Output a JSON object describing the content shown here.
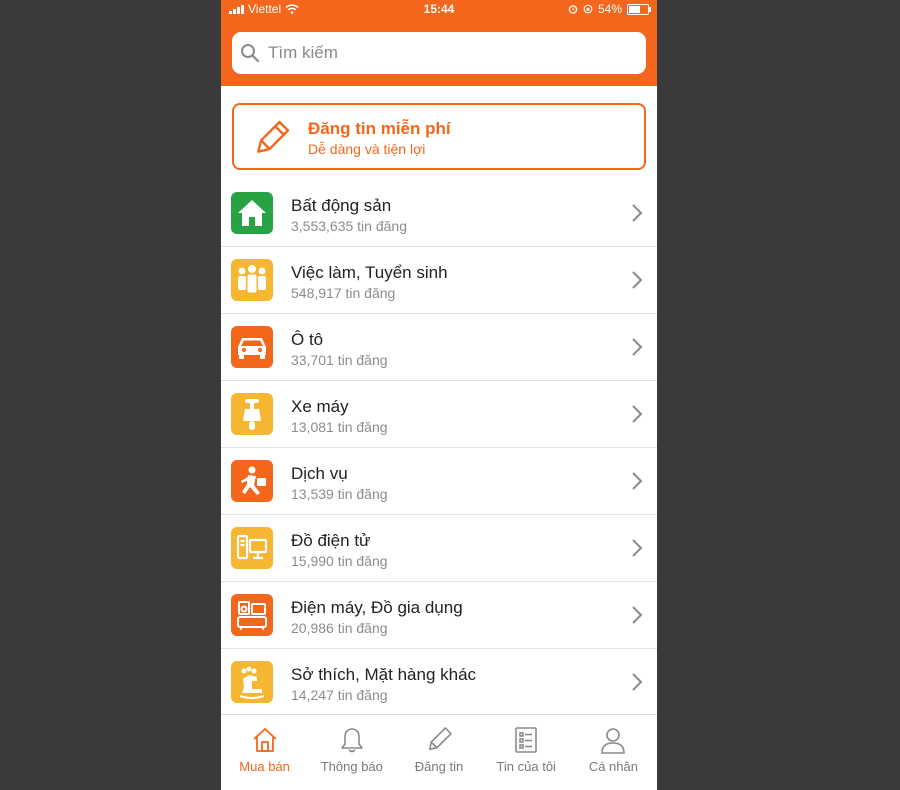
{
  "status_bar": {
    "carrier": "Viettel",
    "time": "15:44",
    "battery": "54%",
    "battery_level": 0.54
  },
  "search": {
    "placeholder": "Tìm kiếm"
  },
  "post_banner": {
    "title": "Đăng tin miễn phí",
    "subtitle": "Dễ dàng và tiện lợi"
  },
  "categories": [
    {
      "name": "Bất động sản",
      "count": "3,553,635 tin đăng",
      "icon": "house-icon",
      "color": "#27a344"
    },
    {
      "name": "Việc làm, Tuyển sinh",
      "count": "548,917 tin đăng",
      "icon": "people-icon",
      "color": "#f5b731"
    },
    {
      "name": "Ô tô",
      "count": "33,701 tin đăng",
      "icon": "car-icon",
      "color": "#f4661c"
    },
    {
      "name": "Xe máy",
      "count": "13,081 tin đăng",
      "icon": "scooter-icon",
      "color": "#f5b731"
    },
    {
      "name": "Dịch vụ",
      "count": "13,539 tin đăng",
      "icon": "delivery-man-icon",
      "color": "#f4661c"
    },
    {
      "name": "Đồ điện tử",
      "count": "15,990 tin đăng",
      "icon": "computer-icon",
      "color": "#f5b731"
    },
    {
      "name": "Điện máy, Đồ gia dụng",
      "count": "20,986 tin đăng",
      "icon": "appliances-icon",
      "color": "#f4661c"
    },
    {
      "name": "Sở thích, Mặt hàng khác",
      "count": "14,247 tin đăng",
      "icon": "hobby-icon",
      "color": "#f5b731"
    }
  ],
  "tabbar": {
    "items": [
      {
        "label": "Mua bán",
        "icon": "home-icon",
        "active": true
      },
      {
        "label": "Thông báo",
        "icon": "bell-icon",
        "active": false
      },
      {
        "label": "Đăng tin",
        "icon": "pencil-icon",
        "active": false
      },
      {
        "label": "Tin của tôi",
        "icon": "list-icon",
        "active": false
      },
      {
        "label": "Cá nhân",
        "icon": "person-icon",
        "active": false
      }
    ]
  },
  "colors": {
    "accent": "#f4661c",
    "background": "#3a3a3c"
  }
}
